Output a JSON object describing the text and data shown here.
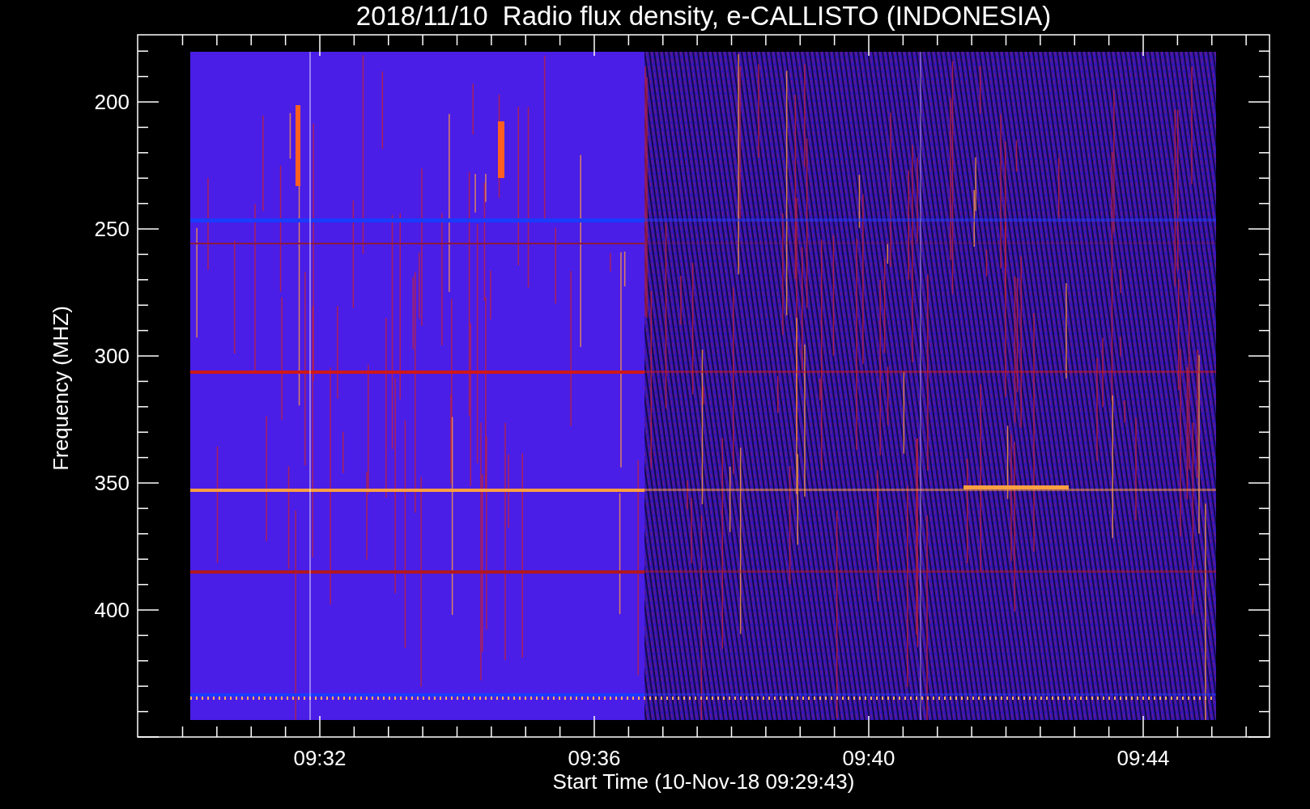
{
  "title": "2018/11/10  Radio flux density, e-CALLISTO (INDONESIA)",
  "chart": {
    "ylabel": "Frequency (MHZ)",
    "xlabel": "Start Time (10-Nov-18 09:29:43)",
    "yticks": [
      "200",
      "250",
      "300",
      "350",
      "400"
    ],
    "xticks": [
      "09:32",
      "09:36",
      "09:40",
      "09:44"
    ]
  }
}
